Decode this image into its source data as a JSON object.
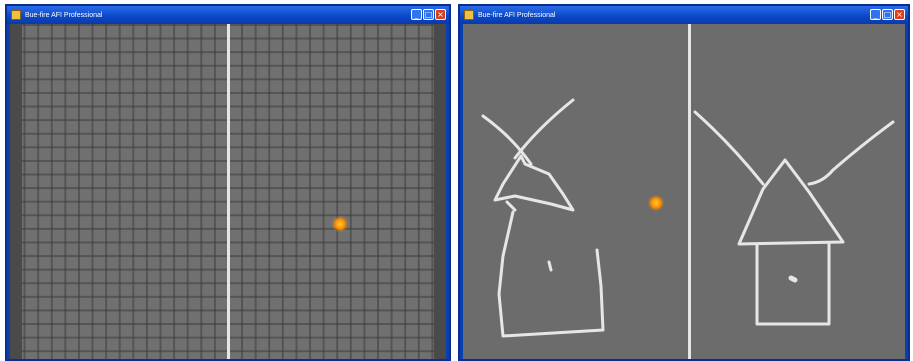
{
  "windows": [
    {
      "title": "Bue-fire AFI Professional",
      "state": "calibration-grid"
    },
    {
      "title": "Bue-fire AFI Professional",
      "state": "drawing"
    }
  ],
  "controls": {
    "minimize": "_",
    "maximize": "□",
    "close": "×"
  },
  "colors": {
    "titlebar": "#0a46c8",
    "canvas": "#6e6e6e",
    "strokes": "#e6e6e6",
    "pointer": "#ff8a00",
    "close_button": "#d9411e"
  }
}
